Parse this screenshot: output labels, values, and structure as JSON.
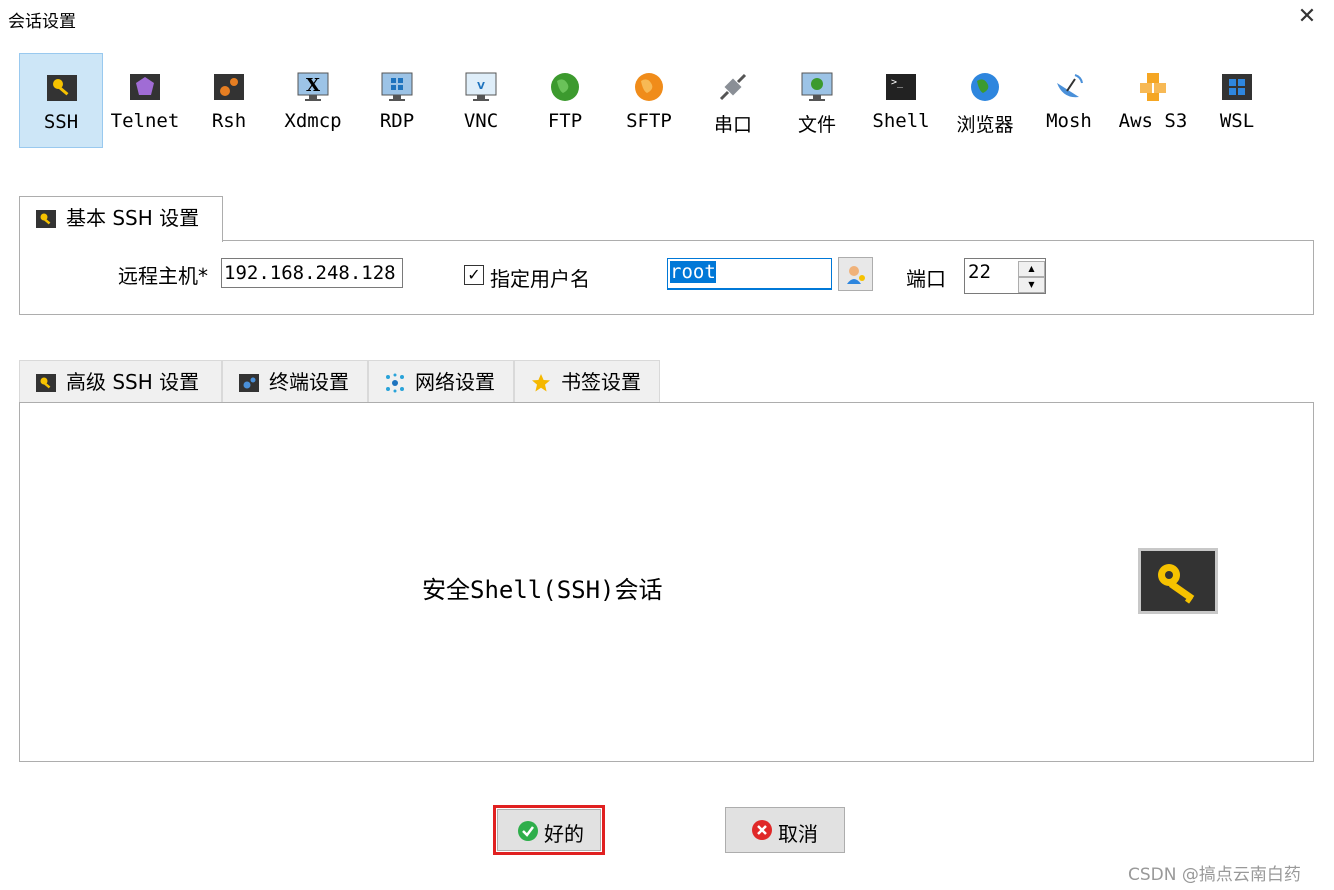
{
  "window": {
    "title": "会话设置",
    "close_icon": "close-icon"
  },
  "session_types": [
    {
      "label": "SSH",
      "icon": "key-icon",
      "selected": true
    },
    {
      "label": "Telnet",
      "icon": "gem-icon"
    },
    {
      "label": "Rsh",
      "icon": "gears-icon"
    },
    {
      "label": "Xdmcp",
      "icon": "x-display-icon"
    },
    {
      "label": "RDP",
      "icon": "windows-monitor-icon"
    },
    {
      "label": "VNC",
      "icon": "vnc-monitor-icon"
    },
    {
      "label": "FTP",
      "icon": "green-globe-icon"
    },
    {
      "label": "SFTP",
      "icon": "orange-globe-icon"
    },
    {
      "label": "串口",
      "icon": "serial-plug-icon"
    },
    {
      "label": "文件",
      "icon": "file-monitor-icon"
    },
    {
      "label": "Shell",
      "icon": "terminal-icon"
    },
    {
      "label": "浏览器",
      "icon": "browser-globe-icon"
    },
    {
      "label": "Mosh",
      "icon": "satellite-dish-icon"
    },
    {
      "label": "Aws S3",
      "icon": "aws-cubes-icon"
    },
    {
      "label": "WSL",
      "icon": "wsl-windows-icon"
    }
  ],
  "basic_tab": {
    "label": "基本 SSH 设置"
  },
  "basic": {
    "remote_host_label": "远程主机*",
    "remote_host_value": "192.168.248.128",
    "specify_username_label": "指定用户名",
    "specify_username_checked": true,
    "username_value": "root",
    "port_label": "端口",
    "port_value": "22"
  },
  "advanced_tabs": [
    {
      "label": "高级 SSH 设置",
      "icon": "key-icon",
      "active": true
    },
    {
      "label": "终端设置",
      "icon": "terminal-settings-icon"
    },
    {
      "label": "网络设置",
      "icon": "network-icon"
    },
    {
      "label": "书签设置",
      "icon": "star-icon"
    }
  ],
  "description": "安全Shell(SSH)会话",
  "buttons": {
    "ok": "好的",
    "cancel": "取消"
  },
  "colors": {
    "selected_bg": "#cde6f7",
    "highlight_border": "#e02020"
  },
  "watermark": "CSDN @搞点云南白药"
}
